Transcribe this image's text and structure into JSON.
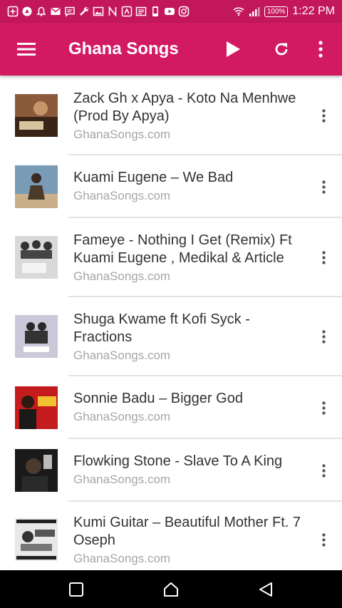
{
  "status_bar": {
    "time": "1:22 PM",
    "battery": "100%",
    "left_icons": [
      "add-box-icon",
      "app-icon",
      "notification-icon",
      "gmail-icon",
      "message-icon",
      "wrench-icon",
      "image-icon",
      "n-icon",
      "app2-icon",
      "news-icon",
      "phone-icon",
      "youtube-icon",
      "instagram-icon"
    ]
  },
  "app_bar": {
    "title": "Ghana Songs",
    "color": "#d21a63"
  },
  "songs": [
    {
      "title": "Zack Gh x Apya - Koto Na Menhwe (Prod By Apya)",
      "source": "GhanaSongs.com",
      "thumb_color": "#8a5a3a"
    },
    {
      "title": "Kuami Eugene – We Bad",
      "source": "GhanaSongs.com",
      "thumb_color": "#7a9bb5"
    },
    {
      "title": "Fameye - Nothing I Get (Remix) Ft Kuami Eugene , Medikal & Article",
      "source": "GhanaSongs.com",
      "thumb_color": "#d9d9d9"
    },
    {
      "title": "Shuga Kwame ft Kofi Syck - Fractions",
      "source": "GhanaSongs.com",
      "thumb_color": "#c9c9d9"
    },
    {
      "title": "Sonnie Badu – Bigger God",
      "source": "GhanaSongs.com",
      "thumb_color": "#c41c1c"
    },
    {
      "title": "Flowking Stone - Slave To A King",
      "source": "GhanaSongs.com",
      "thumb_color": "#1a1a1a"
    },
    {
      "title": "Kumi Guitar – Beautiful Mother Ft. 7 Oseph",
      "source": "GhanaSongs.com",
      "thumb_color": "#e8e8e8"
    }
  ]
}
